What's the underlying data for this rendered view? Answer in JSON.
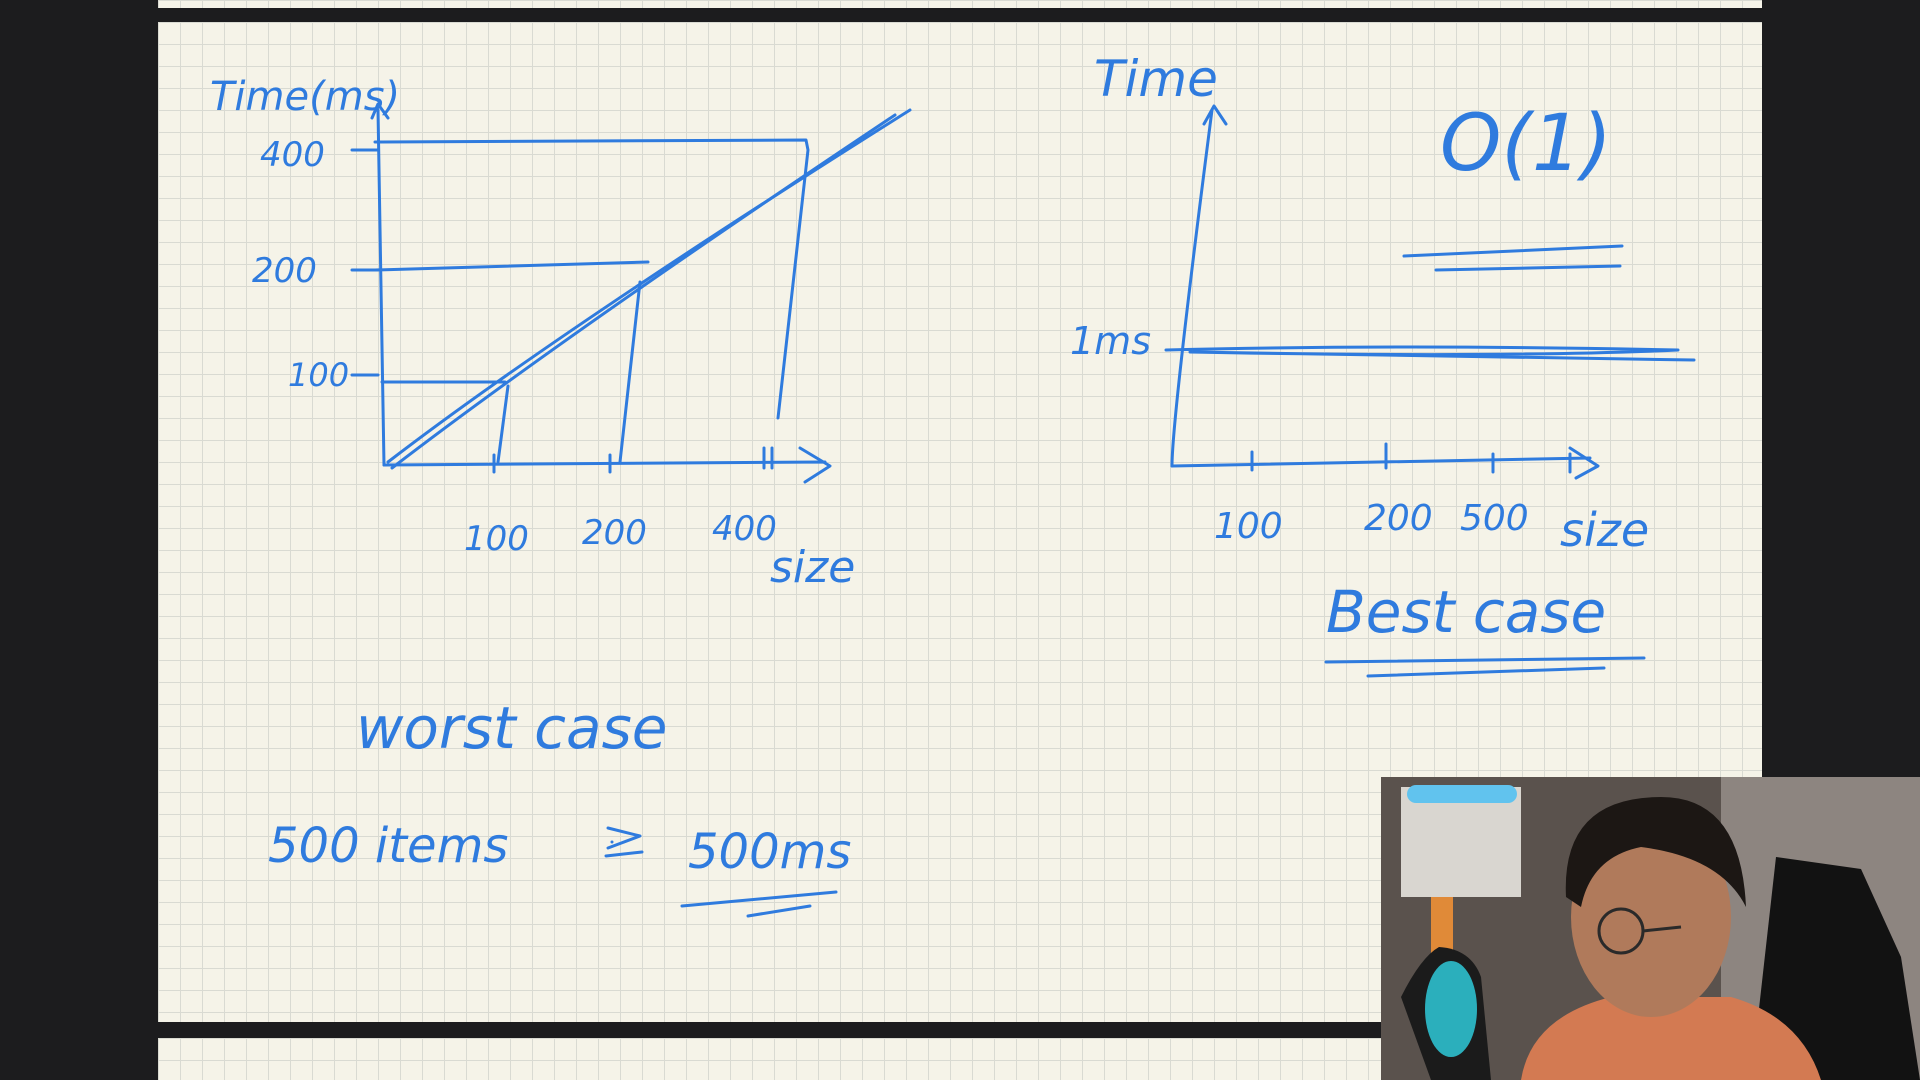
{
  "left_graph": {
    "y_axis_label": "Time(ms)",
    "y_ticks": [
      "400",
      "200",
      "100"
    ],
    "x_ticks": [
      "100",
      "200",
      "400"
    ],
    "x_axis_label": "size",
    "caption": "worst case",
    "note_left": "500 items",
    "note_right": "500ms"
  },
  "right_graph": {
    "y_axis_label": "Time",
    "y_tick": "1ms",
    "x_ticks": [
      "100",
      "200",
      "500"
    ],
    "x_axis_label": "size",
    "complexity": "O(1)",
    "caption": "Best case"
  },
  "colors": {
    "ink": "#2f7bde",
    "paper": "#f5f3e8",
    "grid": "#d9dad2",
    "background": "#1c1c1e"
  }
}
